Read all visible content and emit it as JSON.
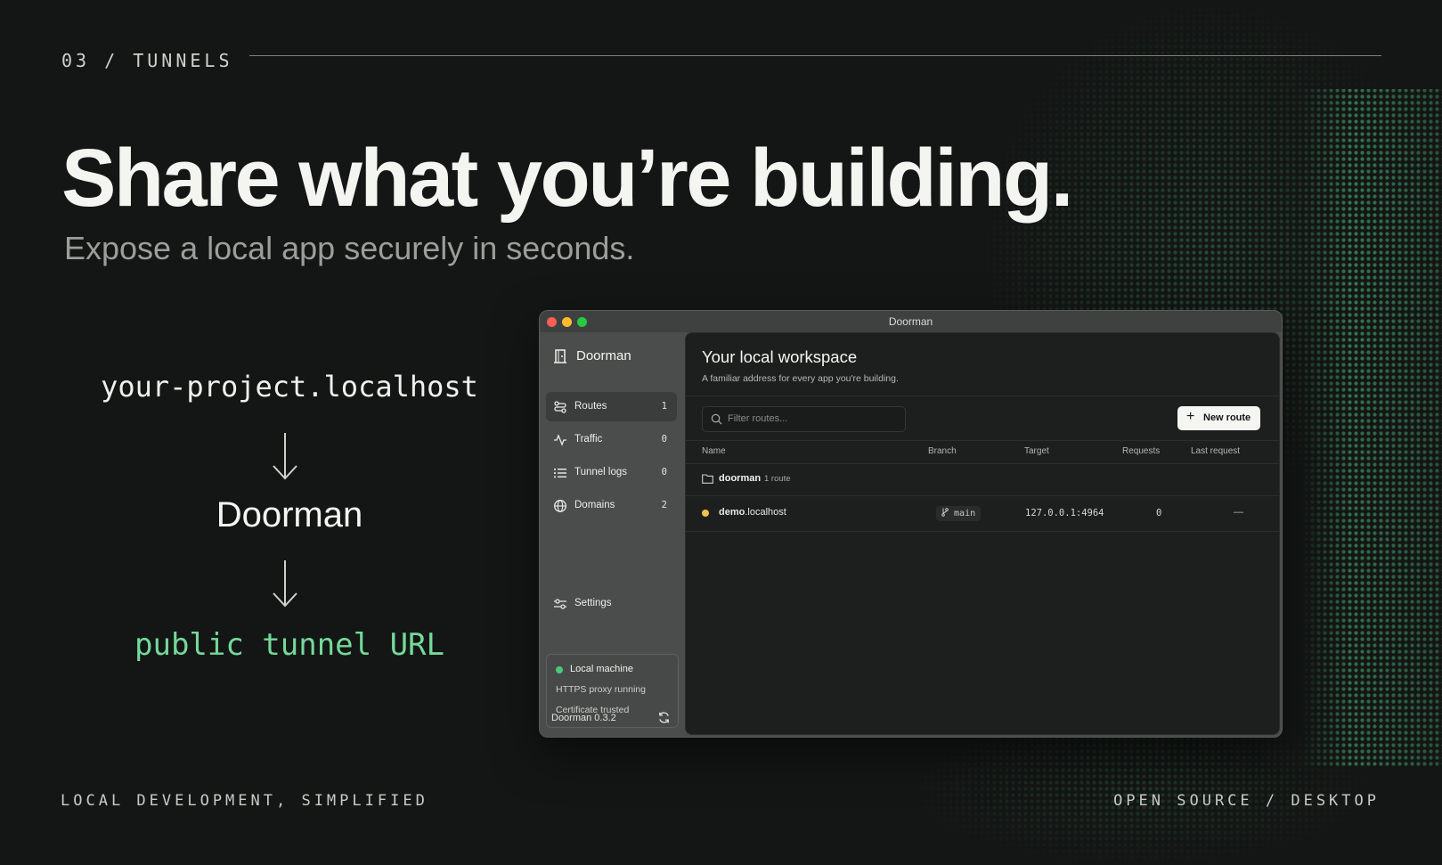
{
  "eyebrow": "03 / TUNNELS",
  "headline": "Share what you’re building.",
  "subheadline": "Expose a local app securely in seconds.",
  "flow": {
    "local_address": "your-project.localhost",
    "arrow_glyph": "↓",
    "middle": "Doorman",
    "destination": "public tunnel URL"
  },
  "footer": {
    "left": "LOCAL DEVELOPMENT, SIMPLIFIED",
    "right": "OPEN SOURCE / DESKTOP"
  },
  "window": {
    "title": "Doorman",
    "sidebar": {
      "brand": "Doorman",
      "items": [
        {
          "label": "Routes",
          "count": "1",
          "icon": "routes-icon",
          "active": true
        },
        {
          "label": "Traffic",
          "count": "0",
          "icon": "activity-icon",
          "active": false
        },
        {
          "label": "Tunnel logs",
          "count": "0",
          "icon": "list-icon",
          "active": false
        },
        {
          "label": "Domains",
          "count": "2",
          "icon": "globe-icon",
          "active": false
        }
      ],
      "settings_label": "Settings",
      "status": {
        "title": "Local machine",
        "line1": "HTTPS proxy running",
        "line2": "Certificate trusted"
      },
      "version": "Doorman 0.3.2"
    },
    "main": {
      "title": "Your local workspace",
      "subtitle": "A familiar address for every app you're building.",
      "filter_placeholder": "Filter routes...",
      "new_button": "New route",
      "columns": {
        "name": "Name",
        "branch": "Branch",
        "target": "Target",
        "requests": "Requests",
        "last_request": "Last request"
      },
      "group": {
        "name": "doorman",
        "meta": "1 route"
      },
      "route": {
        "name_bold": "demo",
        "name_suffix": ".localhost",
        "branch": "main",
        "target": "127.0.0.1:4964",
        "requests": "0",
        "last_request": "—"
      }
    }
  },
  "colors": {
    "background": "#141615",
    "accent_green": "#73d99a",
    "status_green": "#4cc77a",
    "status_amber": "#f2c14e",
    "traffic_red": "#ff5f57",
    "traffic_yellow": "#febc2e",
    "traffic_green": "#28c840"
  }
}
